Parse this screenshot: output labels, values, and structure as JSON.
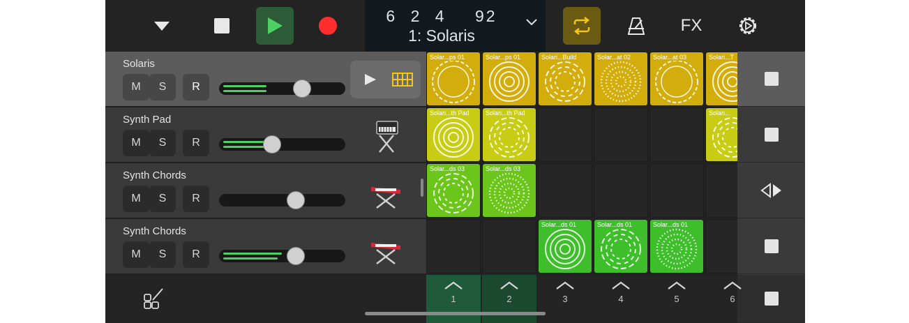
{
  "transport": {
    "position": "6 2 4",
    "tempo": "92",
    "song_title": "1: Solaris"
  },
  "toolbar": {
    "fx_label": "FX"
  },
  "colors": {
    "gold": "#d3ad0b",
    "yellow_green": "#c8cc14",
    "green": "#6cc51a",
    "bright_green": "#3fbe2b",
    "record": "#ff2d2d",
    "play": "#4ccf63"
  },
  "tracks": [
    {
      "name": "Solaris",
      "m": "M",
      "s": "S",
      "r": "R",
      "record_armed": true,
      "volume": 0.66,
      "selected": true
    },
    {
      "name": "Synth Pad",
      "m": "M",
      "s": "S",
      "r": "R",
      "record_armed": false,
      "volume": 0.41
    },
    {
      "name": "Synth Chords",
      "m": "M",
      "s": "S",
      "r": "R",
      "record_armed": false,
      "volume": 0.61
    },
    {
      "name": "Synth Chords",
      "m": "M",
      "s": "S",
      "r": "R",
      "record_armed": false,
      "volume": 0.61
    }
  ],
  "clips": [
    {
      "label": "Solar...ps 01",
      "row": 0,
      "col": 0,
      "color": "gold"
    },
    {
      "label": "Solar...ps 01",
      "row": 0,
      "col": 1,
      "color": "gold"
    },
    {
      "label": "Solari...Build",
      "row": 0,
      "col": 2,
      "color": "gold"
    },
    {
      "label": "Solar...at 02",
      "row": 0,
      "col": 3,
      "color": "gold"
    },
    {
      "label": "Solar...at 03",
      "row": 0,
      "col": 4,
      "color": "gold"
    },
    {
      "label": "Solari...T",
      "row": 0,
      "col": 5,
      "color": "gold"
    },
    {
      "label": "Solari...th Pad",
      "row": 1,
      "col": 0,
      "color": "yellow_green"
    },
    {
      "label": "Solari...th Pad",
      "row": 1,
      "col": 1,
      "color": "yellow_green"
    },
    {
      "label": "Solari...",
      "row": 1,
      "col": 5,
      "color": "yellow_green"
    },
    {
      "label": "Solar...ds 03",
      "row": 2,
      "col": 0,
      "color": "green"
    },
    {
      "label": "Solar...ds 03",
      "row": 2,
      "col": 1,
      "color": "green"
    },
    {
      "label": "Solar...ds 01",
      "row": 3,
      "col": 2,
      "color": "bright_green"
    },
    {
      "label": "Solar...ds 01",
      "row": 3,
      "col": 3,
      "color": "bright_green"
    },
    {
      "label": "Solar...ds 01",
      "row": 3,
      "col": 4,
      "color": "bright_green"
    }
  ],
  "columns": [
    "1",
    "2",
    "3",
    "4",
    "5",
    "6"
  ],
  "icons": {
    "menu": "triangle-down-icon",
    "stop": "stop-icon",
    "play": "play-icon",
    "record": "record-icon",
    "cycle": "cycle-icon",
    "metronome": "metronome-icon",
    "settings": "gear-icon",
    "instrument_browser": "grid-edit-icon",
    "keyboard": "keyboard-stand-icon",
    "drum_grid": "drum-grid-icon"
  }
}
